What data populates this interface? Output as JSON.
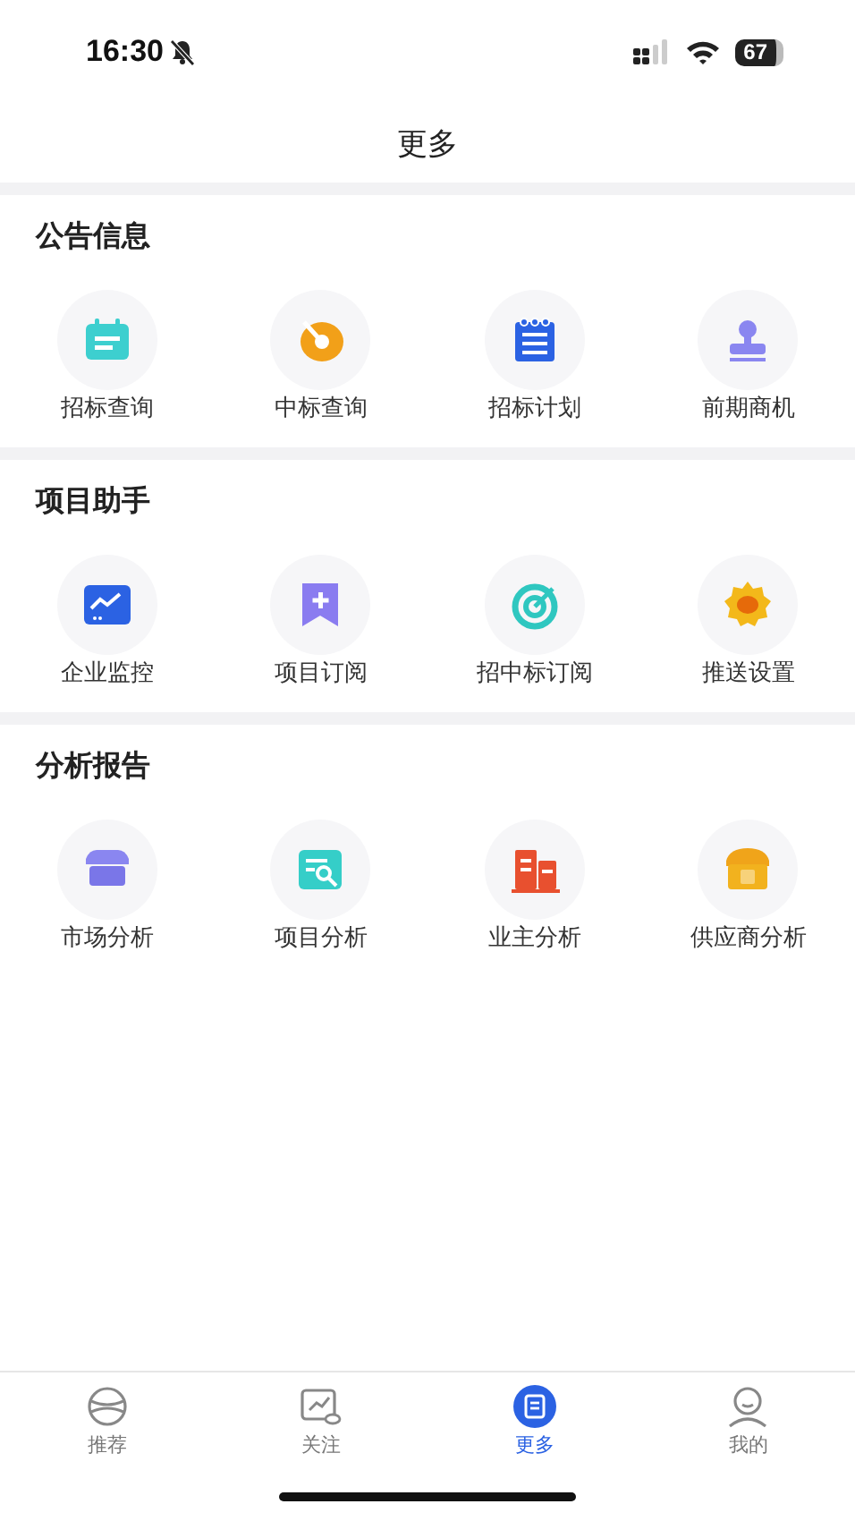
{
  "status_bar": {
    "time": "16:30",
    "battery": "67"
  },
  "header": {
    "title": "更多"
  },
  "sections": [
    {
      "title": "公告信息",
      "items": [
        {
          "label": "招标查询"
        },
        {
          "label": "中标查询"
        },
        {
          "label": "招标计划"
        },
        {
          "label": "前期商机"
        }
      ]
    },
    {
      "title": "项目助手",
      "items": [
        {
          "label": "企业监控"
        },
        {
          "label": "项目订阅"
        },
        {
          "label": "招中标订阅"
        },
        {
          "label": "推送设置"
        }
      ]
    },
    {
      "title": "分析报告",
      "items": [
        {
          "label": "市场分析"
        },
        {
          "label": "项目分析"
        },
        {
          "label": "业主分析"
        },
        {
          "label": "供应商分析"
        }
      ]
    }
  ],
  "tab_bar": [
    {
      "label": "推荐",
      "selected": false
    },
    {
      "label": "关注",
      "selected": false
    },
    {
      "label": "更多",
      "selected": true
    },
    {
      "label": "我的",
      "selected": false
    }
  ]
}
